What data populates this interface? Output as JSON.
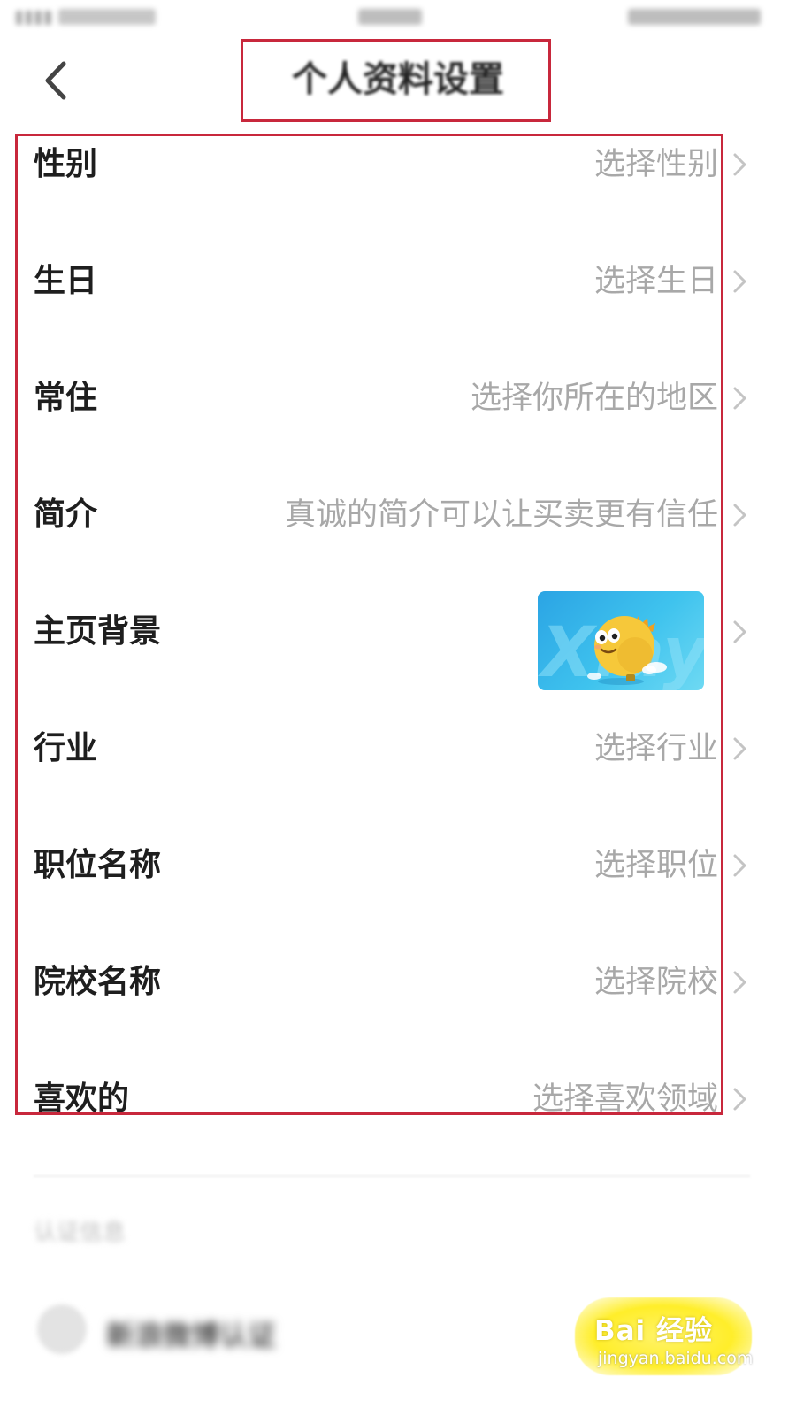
{
  "header": {
    "title": "个人资料设置"
  },
  "settings": {
    "items": [
      {
        "label": "性别",
        "value": "选择性别"
      },
      {
        "label": "生日",
        "value": "选择生日"
      },
      {
        "label": "常住",
        "value": "选择你所在的地区"
      },
      {
        "label": "简介",
        "value": "真诚的简介可以让买卖更有信任"
      },
      {
        "label": "主页背景",
        "value": ""
      },
      {
        "label": "行业",
        "value": "选择行业"
      },
      {
        "label": "职位名称",
        "value": "选择职位"
      },
      {
        "label": "院校名称",
        "value": "选择院校"
      },
      {
        "label": "喜欢的",
        "value": "选择喜欢领域"
      }
    ]
  },
  "lower_section": {
    "title": "认证信息",
    "cert_name": "新浪微博认证"
  },
  "watermark": {
    "brand": "Bai 经验",
    "url": "jingyan.baidu.com"
  },
  "colors": {
    "annotation_red": "#c8283c",
    "value_gray": "#a8a8a8",
    "label_black": "#1e1e1e"
  },
  "icons": {
    "back": "chevron-left-icon",
    "row_arrow": "chevron-right-icon",
    "background_thumbnail": "mascot-thumbnail"
  }
}
